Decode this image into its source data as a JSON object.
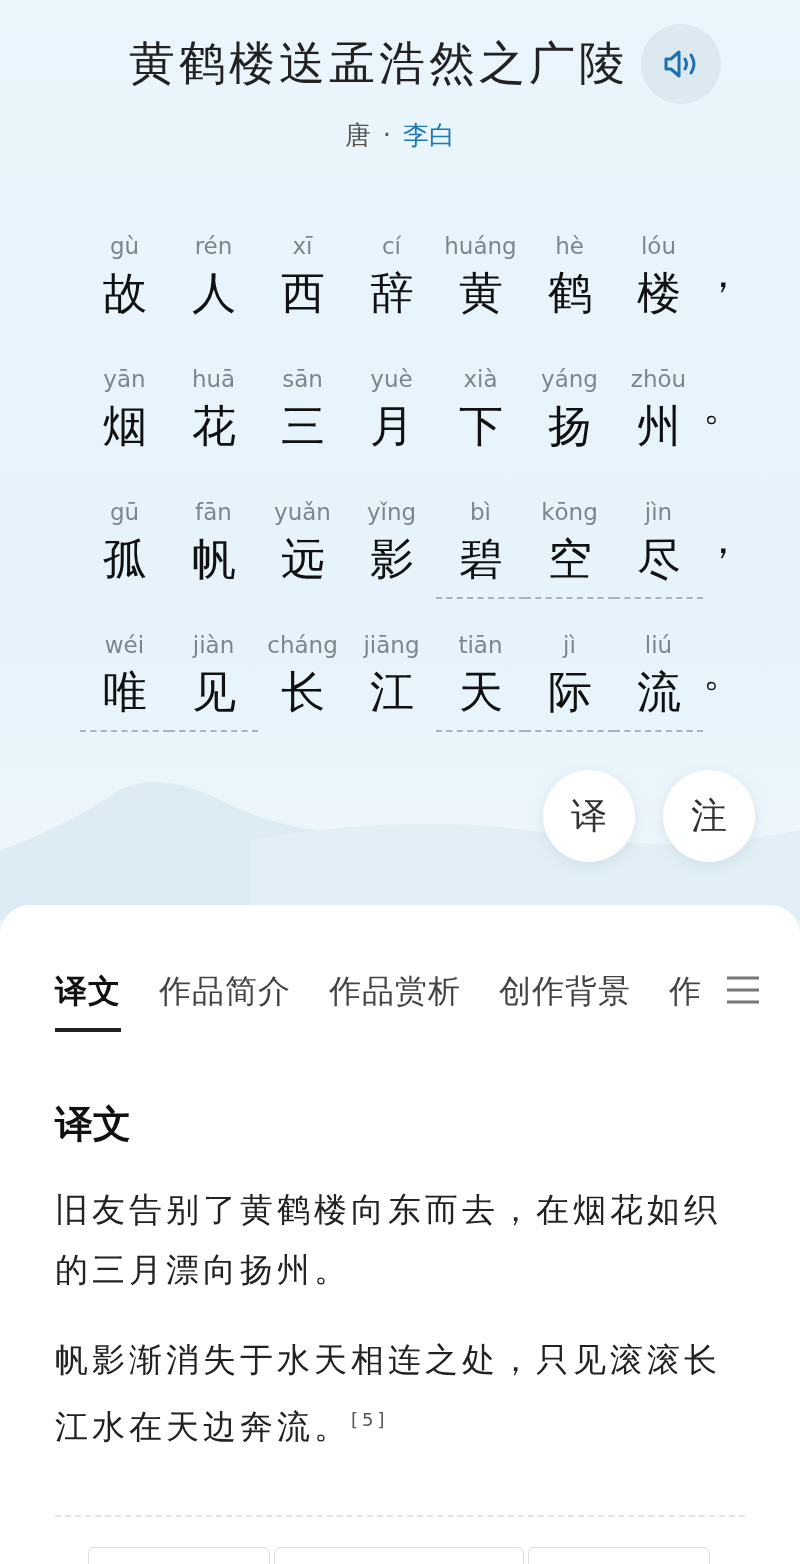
{
  "poem": {
    "title": "黄鹤楼送孟浩然之广陵",
    "dynasty": "唐",
    "separator": "·",
    "author": "李白",
    "lines": [
      {
        "punct": "，",
        "chars": [
          {
            "py": "gù",
            "ch": "故",
            "annotated": false
          },
          {
            "py": "rén",
            "ch": "人",
            "annotated": false
          },
          {
            "py": "xī",
            "ch": "西",
            "annotated": false
          },
          {
            "py": "cí",
            "ch": "辞",
            "annotated": false
          },
          {
            "py": "huáng",
            "ch": "黄",
            "annotated": false
          },
          {
            "py": "hè",
            "ch": "鹤",
            "annotated": false
          },
          {
            "py": "lóu",
            "ch": "楼",
            "annotated": false
          }
        ]
      },
      {
        "punct": "。",
        "chars": [
          {
            "py": "yān",
            "ch": "烟",
            "annotated": false
          },
          {
            "py": "huā",
            "ch": "花",
            "annotated": false
          },
          {
            "py": "sān",
            "ch": "三",
            "annotated": false
          },
          {
            "py": "yuè",
            "ch": "月",
            "annotated": false
          },
          {
            "py": "xià",
            "ch": "下",
            "annotated": false
          },
          {
            "py": "yáng",
            "ch": "扬",
            "annotated": false
          },
          {
            "py": "zhōu",
            "ch": "州",
            "annotated": false
          }
        ]
      },
      {
        "punct": "，",
        "chars": [
          {
            "py": "gū",
            "ch": "孤",
            "annotated": false
          },
          {
            "py": "fān",
            "ch": "帆",
            "annotated": false
          },
          {
            "py": "yuǎn",
            "ch": "远",
            "annotated": false
          },
          {
            "py": "yǐng",
            "ch": "影",
            "annotated": false
          },
          {
            "py": "bì",
            "ch": "碧",
            "annotated": true
          },
          {
            "py": "kōng",
            "ch": "空",
            "annotated": true
          },
          {
            "py": "jìn",
            "ch": "尽",
            "annotated": true
          }
        ]
      },
      {
        "punct": "。",
        "chars": [
          {
            "py": "wéi",
            "ch": "唯",
            "annotated": true
          },
          {
            "py": "jiàn",
            "ch": "见",
            "annotated": true
          },
          {
            "py": "cháng",
            "ch": "长",
            "annotated": false
          },
          {
            "py": "jiāng",
            "ch": "江",
            "annotated": false
          },
          {
            "py": "tiān",
            "ch": "天",
            "annotated": true
          },
          {
            "py": "jì",
            "ch": "际",
            "annotated": true
          },
          {
            "py": "liú",
            "ch": "流",
            "annotated": true
          }
        ]
      }
    ],
    "actions": [
      "译",
      "注"
    ]
  },
  "tabs": [
    {
      "label": "译文",
      "selected": true
    },
    {
      "label": "作品简介",
      "selected": false
    },
    {
      "label": "作品赏析",
      "selected": false
    },
    {
      "label": "创作背景",
      "selected": false
    },
    {
      "label": "作",
      "selected": false
    }
  ],
  "section": {
    "heading": "译文",
    "paragraphs": [
      "旧友告别了黄鹤楼向东而去，在烟花如织的三月漂向扬州。",
      "帆影渐消失于水天相连之处，只见滚滚长江水在天边奔流。$^{[5]}$"
    ]
  }
}
